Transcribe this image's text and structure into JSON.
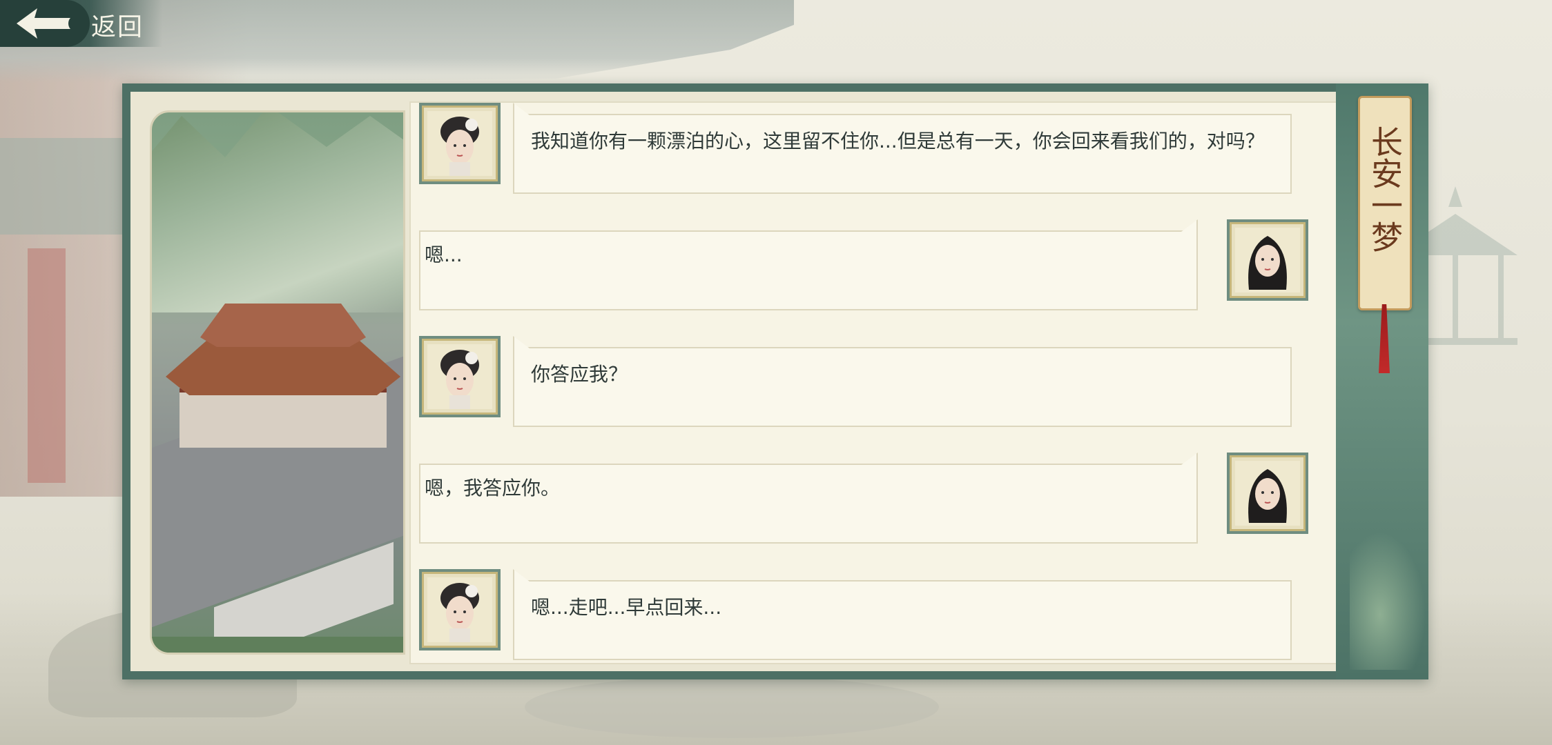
{
  "header": {
    "back_label": "返回"
  },
  "side_title": "长安一梦",
  "colors": {
    "panel_frame": "#4d7065",
    "chat_background": "#f7f4e5",
    "text": "#2f3a38",
    "tab_text": "#6b3a1e",
    "tassel": "#c22a2a"
  },
  "dialogue": [
    {
      "speaker": "npc-woman",
      "side": "left",
      "text": "我知道你有一颗漂泊的心，这里留不住你...但是总有一天，你会回来看我们的，对吗？"
    },
    {
      "speaker": "player",
      "side": "right",
      "text": "嗯..."
    },
    {
      "speaker": "npc-woman",
      "side": "left",
      "text": "你答应我？"
    },
    {
      "speaker": "player",
      "side": "right",
      "text": "嗯，我答应你。"
    },
    {
      "speaker": "npc-woman",
      "side": "left",
      "text": "嗯...走吧...早点回来..."
    }
  ]
}
